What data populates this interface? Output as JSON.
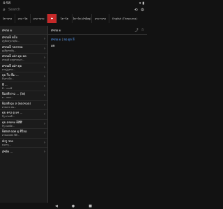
{
  "status": {
    "time": "4:58",
    "wifi": "▾",
    "battery": "▮"
  },
  "search": {
    "placeholder": "Search",
    "value": ""
  },
  "tabs": [
    {
      "label": "ໄທ→ລາວ",
      "active": false
    },
    {
      "label": "ລາວ→ໄທ",
      "active": false
    },
    {
      "label": "ລາວ→ລາວ",
      "active": false
    },
    {
      "label": "",
      "active": true
    },
    {
      "label": "ໄທ→ໄທ",
      "active": false
    },
    {
      "label": "ໄທ→ໄທ (ຄຳພ້ອງ)",
      "active": false
    },
    {
      "label": "ລາວ→ລາວ",
      "active": false
    },
    {
      "label": "English (Thesaurus)",
      "active": false
    }
  ],
  "sidebar": {
    "header": "ສາກລ ພ",
    "items": [
      {
        "title": "ສາກລທ໌ ທຣ໌ນ",
        "sub": "ສູງກ໌ຂອງຣາຊທິດ..."
      },
      {
        "title": "ສາກລທ໌ ຈຣດາກລ",
        "sub": "ຄູເສັ້ງສາກທິງ..."
      },
      {
        "title": "ສາກລທ໌ ພລຳ ຄຸນ ທລ",
        "sub": "ສາກລທ໌ ຂອງສາກພດາ..."
      },
      {
        "title": "ສາກລທ໌ ພລຳ ຄຸນ",
        "sub": "ຄາຖຽງສາຍ..."
      },
      {
        "title": "ຄຸນ ຈ໌ນ ທີ່ມ ...",
        "sub": "ຄັງຄາວລ໌ພ..."
      },
      {
        "title": "ທີ່ ...",
        "sub": "ຄັ... ດາວທ໌"
      },
      {
        "title": "ທ໌ລກທີ ຄາວ ... (ໄທ)",
        "sub": "ກ... ຄຄນ..."
      },
      {
        "title": "ທ໌ລກທີ ຄຸນ ຂ (ທຣດາລກ)",
        "sub": "ຄາກລາຍ ອພ..."
      },
      {
        "title": "ຄຸນ ຄາວ ຄູ ພາ ...",
        "sub": "ທົງ ຄາວລທ໌..."
      },
      {
        "title": "ຄຸນ ລາຄາພ ທ໌ສີສີ",
        "sub": "ທົງ ຄລທລ໌ກ..."
      },
      {
        "title": "ທ໌ສກສ ຄລທ ຄຸ ທີ່ໃກລ",
        "sub": "ຄາກລະອອກ ທີ່ສີ..."
      },
      {
        "title": "ຫ່າງ ຈາລ",
        "sub": "ກລທາງ..."
      },
      {
        "title": "ສຳທ໌ຈ ...",
        "sub": ""
      }
    ]
  },
  "content": {
    "title": "ສາກລ ພ",
    "links": [
      "ສາກລ ພ",
      "ກລ ຕຸກ ກ໌"
    ],
    "separator": "|",
    "meaning": "ພທ"
  },
  "nav": {
    "back": "◀",
    "home": "●",
    "recents": "■"
  }
}
